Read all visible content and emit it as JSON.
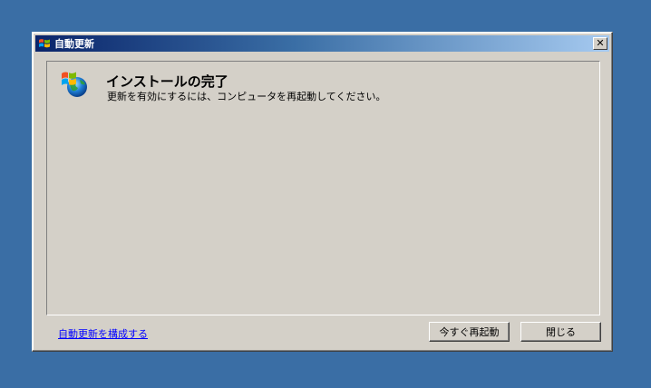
{
  "window": {
    "title": "自動更新",
    "close_glyph": "✕"
  },
  "content": {
    "heading": "インストールの完了",
    "message": "更新を有効にするには、コンピュータを再起動してください。"
  },
  "footer": {
    "configure_link": "自動更新を構成する",
    "restart_button": "今すぐ再起動",
    "close_button": "閉じる"
  },
  "colors": {
    "desktop": "#3a6ea5",
    "titlebar_start": "#0a246a",
    "titlebar_end": "#a6caf0",
    "window_face": "#d4d0c8",
    "link": "#0000ff"
  },
  "icons": {
    "title_icon": "windows-update-icon",
    "panel_icon": "windows-update-globe-icon"
  }
}
